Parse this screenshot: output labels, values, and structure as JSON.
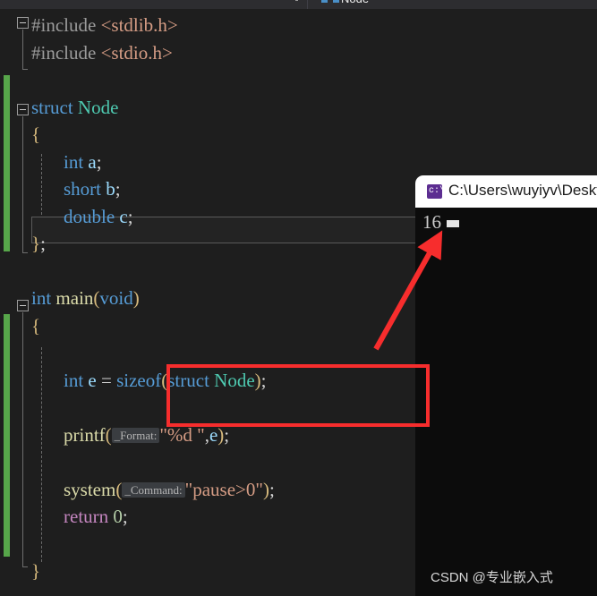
{
  "navbar": {
    "breadcrumb": "Node",
    "icon": "struct-icon"
  },
  "editor": {
    "language": "c",
    "lines": [
      {
        "indent": 0,
        "tokens": [
          {
            "t": "#include ",
            "c": "k-pp"
          },
          {
            "t": "<stdlib.h>",
            "c": "k-str-inc"
          }
        ]
      },
      {
        "indent": 0,
        "tokens": [
          {
            "t": "#include ",
            "c": "k-pp"
          },
          {
            "t": "<stdio.h>",
            "c": "k-str-inc"
          }
        ]
      },
      {
        "indent": 0,
        "tokens": []
      },
      {
        "indent": 0,
        "tokens": [
          {
            "t": "struct ",
            "c": "k-kw"
          },
          {
            "t": "Node",
            "c": "k-type"
          }
        ]
      },
      {
        "indent": 0,
        "tokens": [
          {
            "t": "{",
            "c": "k-brace"
          }
        ]
      },
      {
        "indent": 1,
        "tokens": [
          {
            "t": "int ",
            "c": "k-kw"
          },
          {
            "t": "a",
            "c": "k-var"
          },
          {
            "t": ";",
            "c": "k-punc"
          }
        ]
      },
      {
        "indent": 1,
        "tokens": [
          {
            "t": "short ",
            "c": "k-kw"
          },
          {
            "t": "b",
            "c": "k-var"
          },
          {
            "t": ";",
            "c": "k-punc"
          }
        ]
      },
      {
        "indent": 1,
        "tokens": [
          {
            "t": "double ",
            "c": "k-kw"
          },
          {
            "t": "c",
            "c": "k-var"
          },
          {
            "t": ";",
            "c": "k-punc"
          }
        ]
      },
      {
        "indent": 0,
        "tokens": [
          {
            "t": "}",
            "c": "k-brace"
          },
          {
            "t": ";",
            "c": "k-punc"
          }
        ]
      },
      {
        "indent": 0,
        "tokens": []
      },
      {
        "indent": 0,
        "tokens": [
          {
            "t": "int ",
            "c": "k-kw"
          },
          {
            "t": "main",
            "c": "k-fn"
          },
          {
            "t": "(",
            "c": "k-brace"
          },
          {
            "t": "void",
            "c": "k-kw"
          },
          {
            "t": ")",
            "c": "k-brace"
          }
        ]
      },
      {
        "indent": 0,
        "tokens": [
          {
            "t": "{",
            "c": "k-brace"
          }
        ]
      },
      {
        "indent": 0,
        "tokens": []
      },
      {
        "indent": 1,
        "tokens": [
          {
            "t": "int ",
            "c": "k-kw"
          },
          {
            "t": "e",
            "c": "k-var"
          },
          {
            "t": " = ",
            "c": "k-op"
          },
          {
            "t": "sizeof",
            "c": "k-kw"
          },
          {
            "t": "(",
            "c": "k-brace"
          },
          {
            "t": "struct ",
            "c": "k-kw"
          },
          {
            "t": "Node",
            "c": "k-type"
          },
          {
            "t": ")",
            "c": "k-brace"
          },
          {
            "t": ";",
            "c": "k-punc"
          }
        ]
      },
      {
        "indent": 0,
        "tokens": []
      },
      {
        "indent": 1,
        "tokens": [
          {
            "t": "printf",
            "c": "k-fn"
          },
          {
            "t": "(",
            "c": "k-brace"
          },
          {
            "t": "_Format:",
            "c": "chip"
          },
          {
            "t": "\"%d \"",
            "c": "k-str"
          },
          {
            "t": ",",
            "c": "k-punc"
          },
          {
            "t": "e",
            "c": "k-var"
          },
          {
            "t": ")",
            "c": "k-brace"
          },
          {
            "t": ";",
            "c": "k-punc"
          }
        ]
      },
      {
        "indent": 0,
        "tokens": []
      },
      {
        "indent": 1,
        "tokens": [
          {
            "t": "system",
            "c": "k-fn"
          },
          {
            "t": "(",
            "c": "k-brace"
          },
          {
            "t": "_Command:",
            "c": "chip"
          },
          {
            "t": "\"pause>0\"",
            "c": "k-str"
          },
          {
            "t": ")",
            "c": "k-brace"
          },
          {
            "t": ";",
            "c": "k-punc"
          }
        ]
      },
      {
        "indent": 1,
        "tokens": [
          {
            "t": "return ",
            "c": "k-ret"
          },
          {
            "t": "0",
            "c": "k-num"
          },
          {
            "t": ";",
            "c": "k-punc"
          }
        ]
      },
      {
        "indent": 0,
        "tokens": []
      },
      {
        "indent": 0,
        "tokens": [
          {
            "t": "}",
            "c": "k-brace"
          }
        ]
      }
    ],
    "current_line_text": "double c;",
    "fold_markers": [
      "#include <stdlib.h>",
      "struct Node",
      "int main(void)"
    ],
    "change_bar_color": "#57a64a"
  },
  "console": {
    "title": "C:\\Users\\wuyiyv\\Deskt",
    "icon_label": "c:\\",
    "output": "16",
    "background": "#0c0c0c"
  },
  "annotations": {
    "highlight_box_target": "sizeof(struct Node);",
    "highlight_color": "#f72d2d",
    "arrow_color": "#f72d2d",
    "arrow_points_to": "16"
  },
  "watermark": {
    "text": "CSDN @专业嵌入式"
  }
}
